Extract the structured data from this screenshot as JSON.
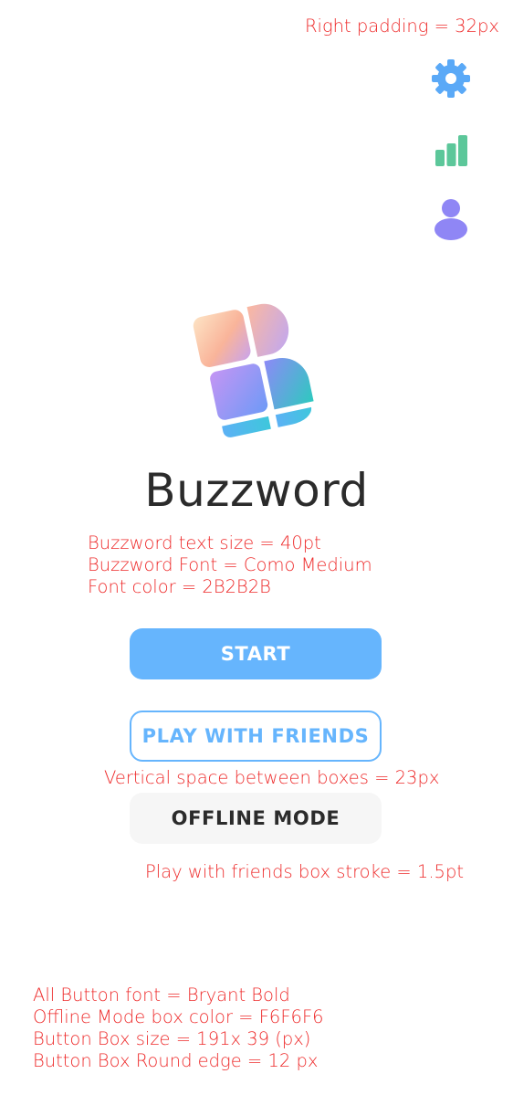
{
  "annotations": {
    "right_padding": "Right padding = 32px",
    "title_size": "Buzzword text size = 40pt",
    "title_font": "Buzzword Font = Como Medium",
    "title_color": "Font color = 2B2B2B",
    "vertical_space": "Vertical space between boxes =  23px",
    "friends_stroke": "Play with friends box stroke = 1.5pt",
    "button_font": "All Button font = Bryant Bold",
    "offline_color": "Offline Mode box color = F6F6F6",
    "box_size": "Button Box size = 191x 39 (px)",
    "box_radius": "Button Box Round edge = 12 px"
  },
  "top_icons": [
    {
      "name": "settings-icon",
      "color": "#5aa9f7"
    },
    {
      "name": "stats-icon",
      "color": "#5cc79a"
    },
    {
      "name": "profile-icon",
      "color": "#8f86f5"
    }
  ],
  "app": {
    "title": "Buzzword",
    "title_color": "#2B2B2B"
  },
  "buttons": {
    "start": "START",
    "play_with_friends": "PLAY WITH FRIENDS",
    "offline_mode": "OFFLINE MODE"
  },
  "colors": {
    "accent": "#66B5FD",
    "offline_box": "#F6F6F6",
    "annotation": "#EE2B2B"
  }
}
